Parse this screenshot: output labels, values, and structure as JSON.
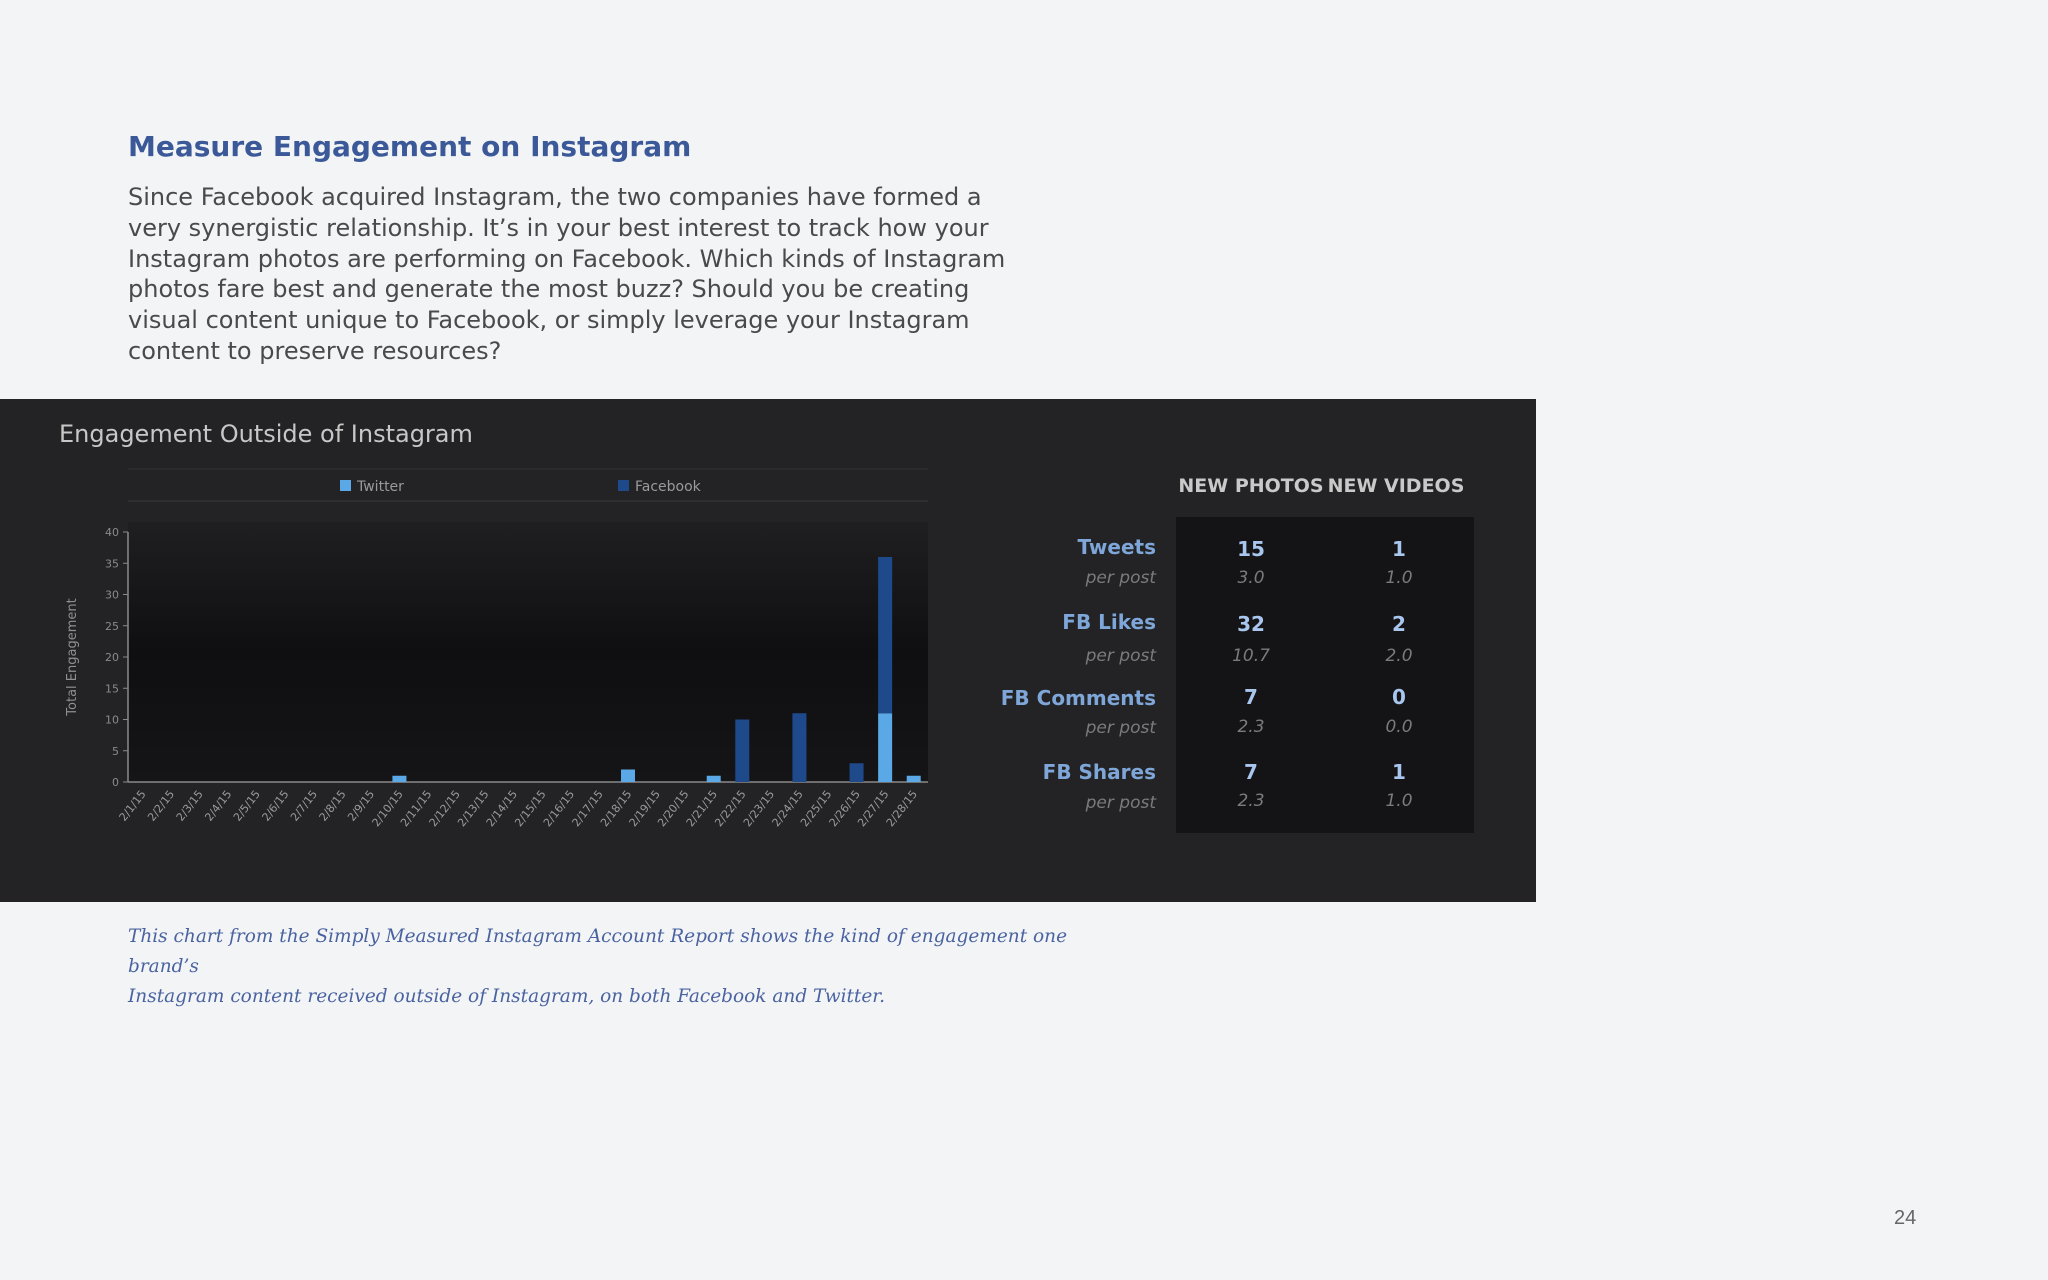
{
  "heading": "Measure Engagement on Instagram",
  "body": "Since Facebook acquired Instagram, the two companies have formed a very synergistic relationship. It’s in your best interest to track how your Instagram photos are performing on Facebook. Which kinds of Instagram photos fare best and generate the most buzz? Should you be creating visual content unique to Facebook, or simply leverage your Instagram content to preserve resources?",
  "panel_title": "Engagement Outside of Instagram",
  "caption_line1": "This chart from the Simply Measured Instagram Account Report shows the kind of engagement one brand’s",
  "caption_line2": "Instagram content received outside of Instagram, on both Facebook and Twitter.",
  "page_number": "24",
  "colors": {
    "heading": "#3b5998",
    "twitter": "#5aa9e6",
    "facebook": "#1e4a8c",
    "panel_bg": "#232325"
  },
  "chart_data": {
    "type": "bar",
    "stacked": true,
    "ylabel": "Total Engagement",
    "ylim": [
      0,
      40
    ],
    "yticks": [
      "0",
      "5",
      "10",
      "15",
      "20",
      "25",
      "30",
      "35",
      "40"
    ],
    "legend_position": "top",
    "categories": [
      "2/1/15",
      "2/2/15",
      "2/3/15",
      "2/4/15",
      "2/5/15",
      "2/6/15",
      "2/7/15",
      "2/8/15",
      "2/9/15",
      "2/10/15",
      "2/11/15",
      "2/12/15",
      "2/13/15",
      "2/14/15",
      "2/15/15",
      "2/16/15",
      "2/17/15",
      "2/18/15",
      "2/19/15",
      "2/20/15",
      "2/21/15",
      "2/22/15",
      "2/23/15",
      "2/24/15",
      "2/25/15",
      "2/26/15",
      "2/27/15",
      "2/28/15"
    ],
    "series": [
      {
        "name": "Twitter",
        "values": [
          0,
          0,
          0,
          0,
          0,
          0,
          0,
          0,
          0,
          1,
          0,
          0,
          0,
          0,
          0,
          0,
          0,
          2,
          0,
          0,
          1,
          0,
          0,
          0,
          0,
          0,
          11,
          1
        ]
      },
      {
        "name": "Facebook",
        "values": [
          0,
          0,
          0,
          0,
          0,
          0,
          0,
          0,
          0,
          0,
          0,
          0,
          0,
          0,
          0,
          0,
          0,
          0,
          0,
          0,
          0,
          10,
          0,
          11,
          0,
          3,
          25,
          0
        ]
      }
    ]
  },
  "stats": {
    "columns": [
      "NEW PHOTOS",
      "NEW VIDEOS"
    ],
    "rows": [
      {
        "label": "Tweets",
        "sub": "per post",
        "photos": "15",
        "photos_per": "3.0",
        "videos": "1",
        "videos_per": "1.0"
      },
      {
        "label": "FB Likes",
        "sub": "per post",
        "photos": "32",
        "photos_per": "10.7",
        "videos": "2",
        "videos_per": "2.0"
      },
      {
        "label": "FB Comments",
        "sub": "per post",
        "photos": "7",
        "photos_per": "2.3",
        "videos": "0",
        "videos_per": "0.0"
      },
      {
        "label": "FB Shares",
        "sub": "per post",
        "photos": "7",
        "photos_per": "2.3",
        "videos": "1",
        "videos_per": "1.0"
      }
    ]
  }
}
